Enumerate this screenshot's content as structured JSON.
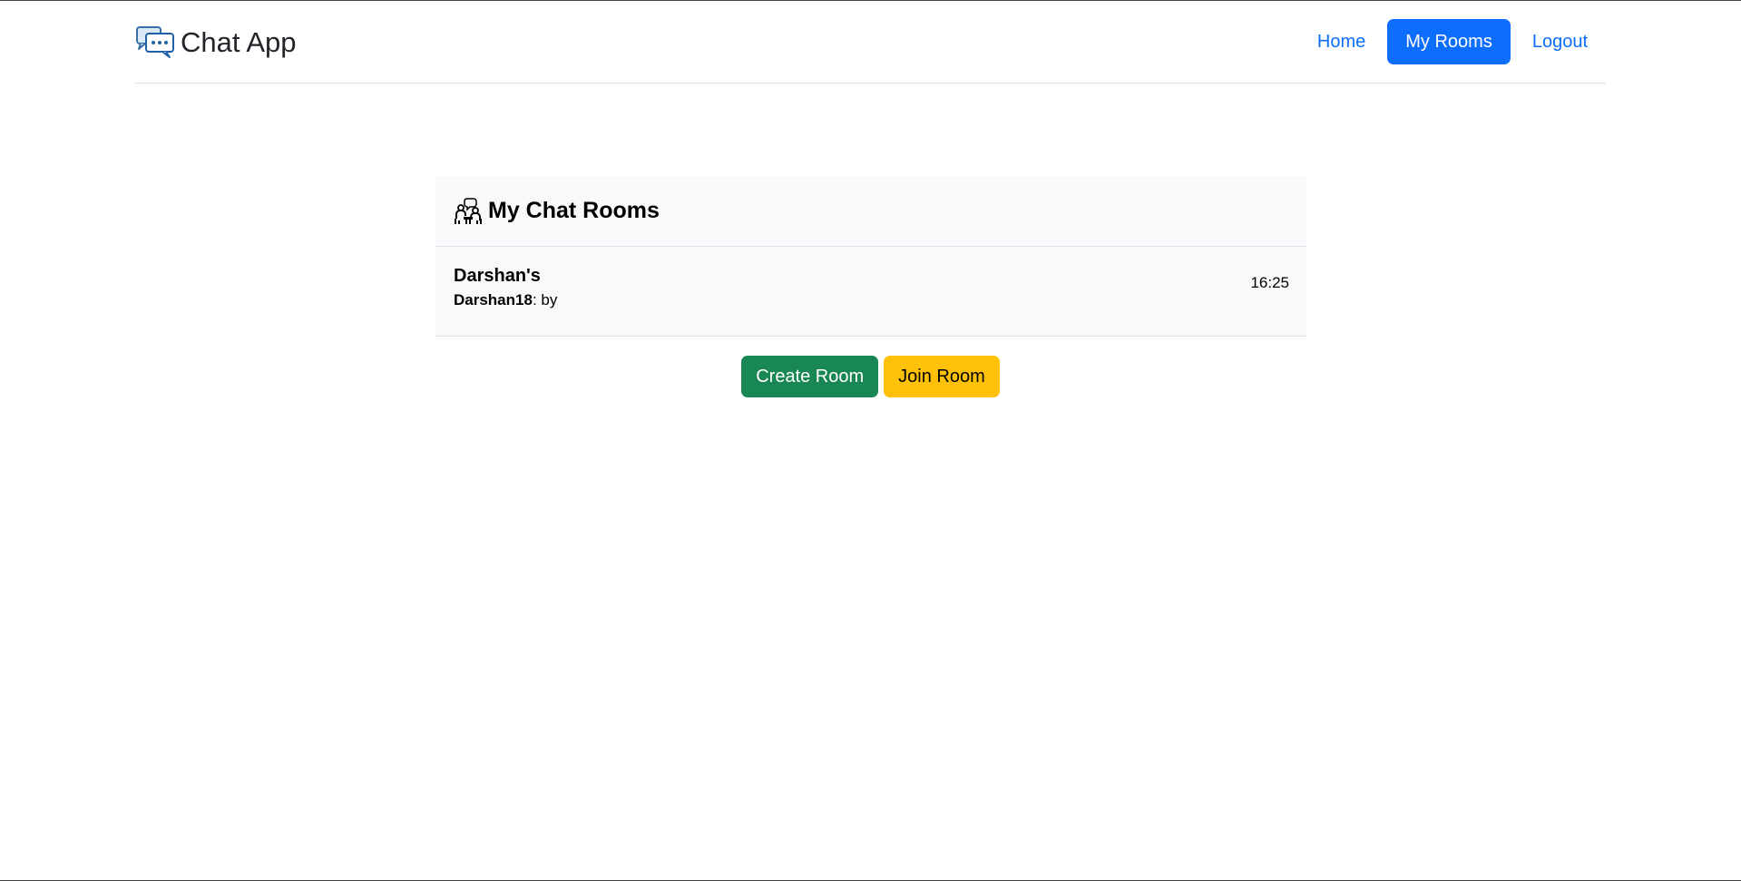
{
  "app": {
    "brand": "Chat App"
  },
  "nav": {
    "items": [
      {
        "label": "Home",
        "active": false
      },
      {
        "label": "My Rooms",
        "active": true
      },
      {
        "label": "Logout",
        "active": false
      }
    ]
  },
  "rooms_card": {
    "title": "My Chat Rooms",
    "rooms": [
      {
        "name": "Darshan's",
        "last_sender": "Darshan18",
        "last_message": ": by",
        "time": "16:25"
      }
    ]
  },
  "actions": {
    "create_label": "Create Room",
    "join_label": "Join Room"
  },
  "colors": {
    "primary": "#0d6efd",
    "success": "#198754",
    "warning": "#ffc107",
    "card_bg": "#f8f9fa"
  },
  "icons": {
    "brand": "chat-bubbles-icon",
    "rooms": "people-chatting-icon"
  }
}
